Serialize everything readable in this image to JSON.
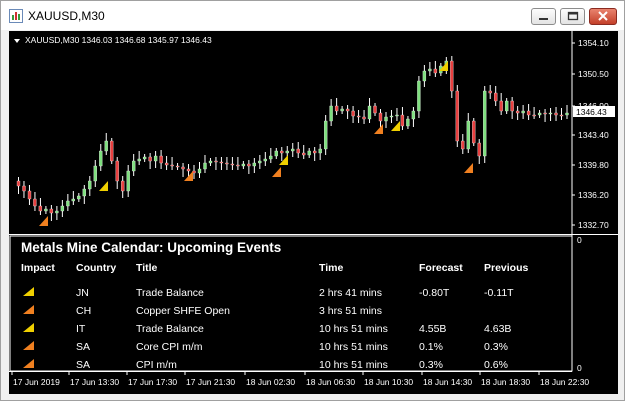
{
  "window": {
    "title": "XAUUSD,M30"
  },
  "chart": {
    "header_text": "XAUUSD,M30  1346.03 1346.68 1345.97 1346.43",
    "price_labels": [
      "1354.10",
      "1350.50",
      "1346.90",
      "1343.40",
      "1339.80",
      "1336.20",
      "1332.70"
    ],
    "current_price": "1346.43",
    "subwindow_scale": [
      "0",
      "0"
    ],
    "time_labels": [
      "17 Jun 2019",
      "17 Jun 13:30",
      "17 Jun 17:30",
      "17 Jun 21:30",
      "18 Jun 02:30",
      "18 Jun 06:30",
      "18 Jun 10:30",
      "18 Jun 14:30",
      "18 Jun 18:30",
      "18 Jun 22:30"
    ],
    "colors": {
      "bull": "#7fe07f",
      "bear": "#e84040",
      "wick": "#ffffff"
    }
  },
  "calendar": {
    "title": "Metals Mine Calendar: Upcoming Events",
    "headers": {
      "impact": "Impact",
      "country": "Country",
      "title": "Title",
      "time": "Time",
      "forecast": "Forecast",
      "previous": "Previous"
    },
    "rows": [
      {
        "impact": "medium",
        "impact_color": "#f0d000",
        "country": "JN",
        "title": "Trade Balance",
        "time": "2 hrs 41 mins",
        "forecast": "-0.80T",
        "previous": "-0.11T"
      },
      {
        "impact": "high",
        "impact_color": "#f08020",
        "country": "CH",
        "title": "Copper SHFE Open",
        "time": "3 hrs 51 mins",
        "forecast": "",
        "previous": ""
      },
      {
        "impact": "medium",
        "impact_color": "#f0d000",
        "country": "IT",
        "title": "Trade Balance",
        "time": "10 hrs 51 mins",
        "forecast": "4.55B",
        "previous": "4.63B"
      },
      {
        "impact": "high",
        "impact_color": "#f08020",
        "country": "SA",
        "title": "Core CPI m/m",
        "time": "10 hrs 51 mins",
        "forecast": "0.1%",
        "previous": "0.3%"
      },
      {
        "impact": "high",
        "impact_color": "#f08020",
        "country": "SA",
        "title": "CPI m/m",
        "time": "10 hrs 51 mins",
        "forecast": "0.3%",
        "previous": "0.6%"
      }
    ]
  }
}
